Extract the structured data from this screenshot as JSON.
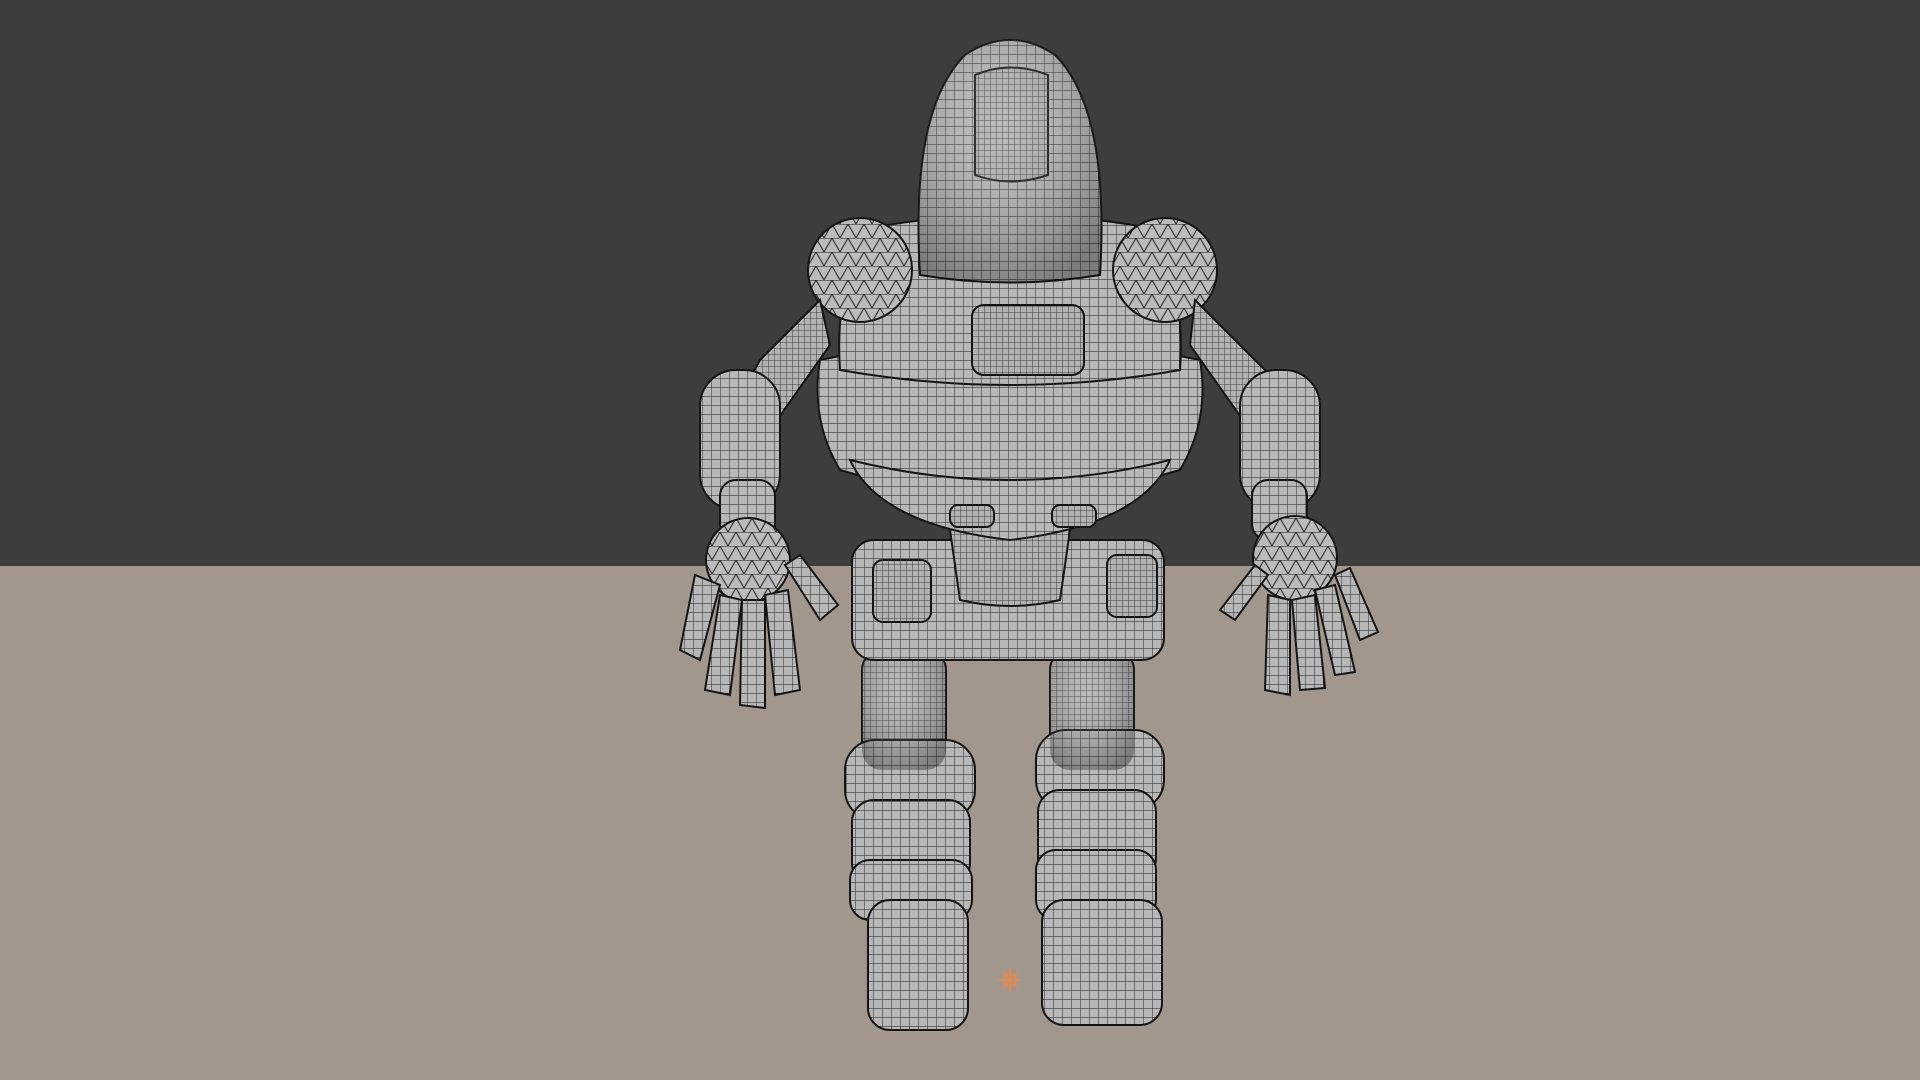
{
  "viewport": {
    "mode": "3d-viewport-wireframe-overlay",
    "background_color": "#3d3d3d",
    "floor_color": "#a1978c",
    "mesh_color": "#b5b5b5",
    "wire_color": "#1b1b1b",
    "origin_marker_color": "#e08a50"
  },
  "scene": {
    "object": "robot-mesh",
    "parts": [
      "head",
      "visor",
      "chest",
      "chest-plate",
      "torso-ring",
      "shoulder-left",
      "shoulder-right",
      "upper-arm-left",
      "upper-arm-right",
      "forearm-left",
      "forearm-right",
      "hand-left",
      "hand-right",
      "waist",
      "hips",
      "leg-left",
      "leg-right",
      "boot-left",
      "boot-right"
    ],
    "has_origin_marker": true
  }
}
